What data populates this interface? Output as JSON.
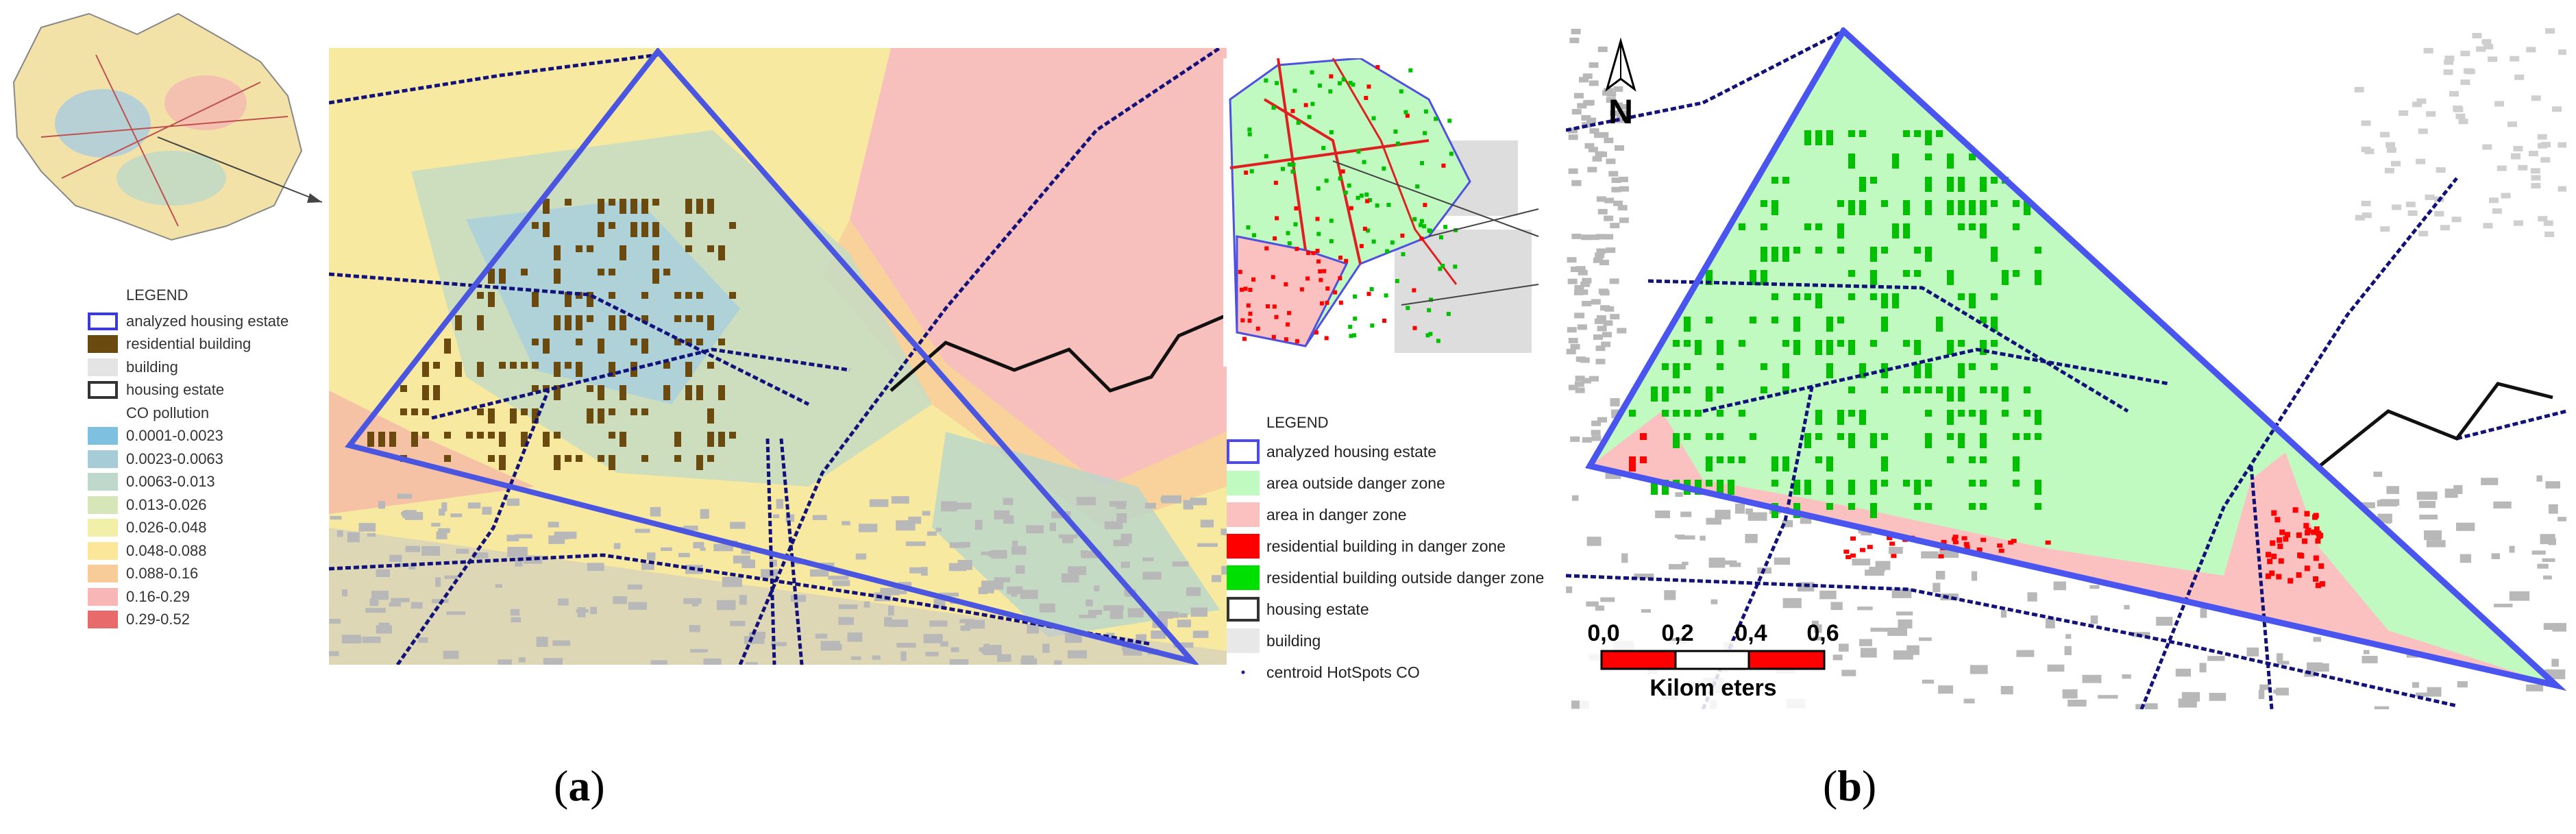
{
  "panel_a": {
    "label_open": "(",
    "label_letter": "a",
    "label_close": ")",
    "legend": {
      "title": "LEGEND",
      "items": [
        {
          "label": "analyzed housing estate",
          "style": "outline",
          "color": "#3a3ad8"
        },
        {
          "label": "residential building",
          "style": "fill",
          "color": "#6b4a10"
        },
        {
          "label": "building",
          "style": "fill",
          "color": "#e4e4e4"
        },
        {
          "label": "housing estate",
          "style": "outline",
          "color": "#333333"
        }
      ],
      "pollution_title": "CO pollution",
      "pollution_classes": [
        {
          "label": "0.0001-0.0023",
          "color": "#7dc0e0"
        },
        {
          "label": "0.0023-0.0063",
          "color": "#a6ccd8"
        },
        {
          "label": "0.0063-0.013",
          "color": "#bfd8cc"
        },
        {
          "label": "0.013-0.026",
          "color": "#d6e6b8"
        },
        {
          "label": "0.026-0.048",
          "color": "#f2f0a8"
        },
        {
          "label": "0.048-0.088",
          "color": "#fbe69a"
        },
        {
          "label": "0.088-0.16",
          "color": "#f8cc98"
        },
        {
          "label": "0.16-0.29",
          "color": "#f8b6b6"
        },
        {
          "label": "0.29-0.52",
          "color": "#e86a6a"
        }
      ]
    }
  },
  "panel_b": {
    "label_open": "(",
    "label_letter": "b",
    "label_close": ")",
    "north_label": "N",
    "legend": {
      "title": "LEGEND",
      "items": [
        {
          "label": "analyzed housing estate",
          "style": "outline",
          "color": "#4a4af0"
        },
        {
          "label": "area outside danger zone",
          "style": "fill",
          "color": "#c0fac0"
        },
        {
          "label": "area in danger zone",
          "style": "fill",
          "color": "#fbc0c0"
        },
        {
          "label": "residential building in danger zone",
          "style": "fill",
          "color": "#ff0000"
        },
        {
          "label": "residential building outside danger zone",
          "style": "fill",
          "color": "#00e000"
        },
        {
          "label": "housing estate",
          "style": "outline",
          "color": "#333333"
        },
        {
          "label": "building",
          "style": "fill",
          "color": "#e8e8e8"
        },
        {
          "label": "centroid HotSpots CO",
          "style": "dot",
          "color": "#1a1a8a"
        }
      ]
    },
    "scale_bar": {
      "ticks": [
        "0,0",
        "0,2",
        "0,4",
        "0,6"
      ],
      "unit": "Kilom eters",
      "colors": [
        "#ff0000",
        "#ffffff",
        "#ff0000"
      ]
    }
  }
}
